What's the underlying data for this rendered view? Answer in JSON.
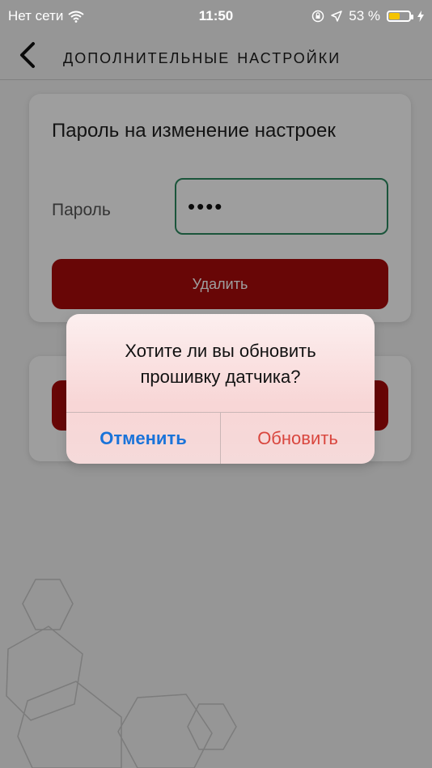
{
  "status_bar": {
    "carrier": "Нет сети",
    "time": "11:50",
    "battery_percent": "53 %",
    "battery_level": 0.53,
    "icons": [
      "wifi-icon",
      "orientation-lock-icon",
      "location-arrow-icon",
      "battery-icon",
      "charging-bolt-icon"
    ]
  },
  "nav": {
    "title": "Дополнительные настройки",
    "back_icon": "chevron-left-icon"
  },
  "password_card": {
    "title": "Пароль на изменение настроек",
    "field_label": "Пароль",
    "field_value": "••••",
    "delete_button": "Удалить"
  },
  "alert": {
    "message": "Хотите ли вы обновить прошивку датчика?",
    "cancel": "Отменить",
    "confirm": "Обновить"
  },
  "colors": {
    "accent_red": "#a80a0a",
    "input_border_green": "#2d8a60",
    "alert_cancel_blue": "#1a73d9",
    "alert_confirm_red": "#d9463e",
    "battery_yellow": "#f5c400"
  }
}
